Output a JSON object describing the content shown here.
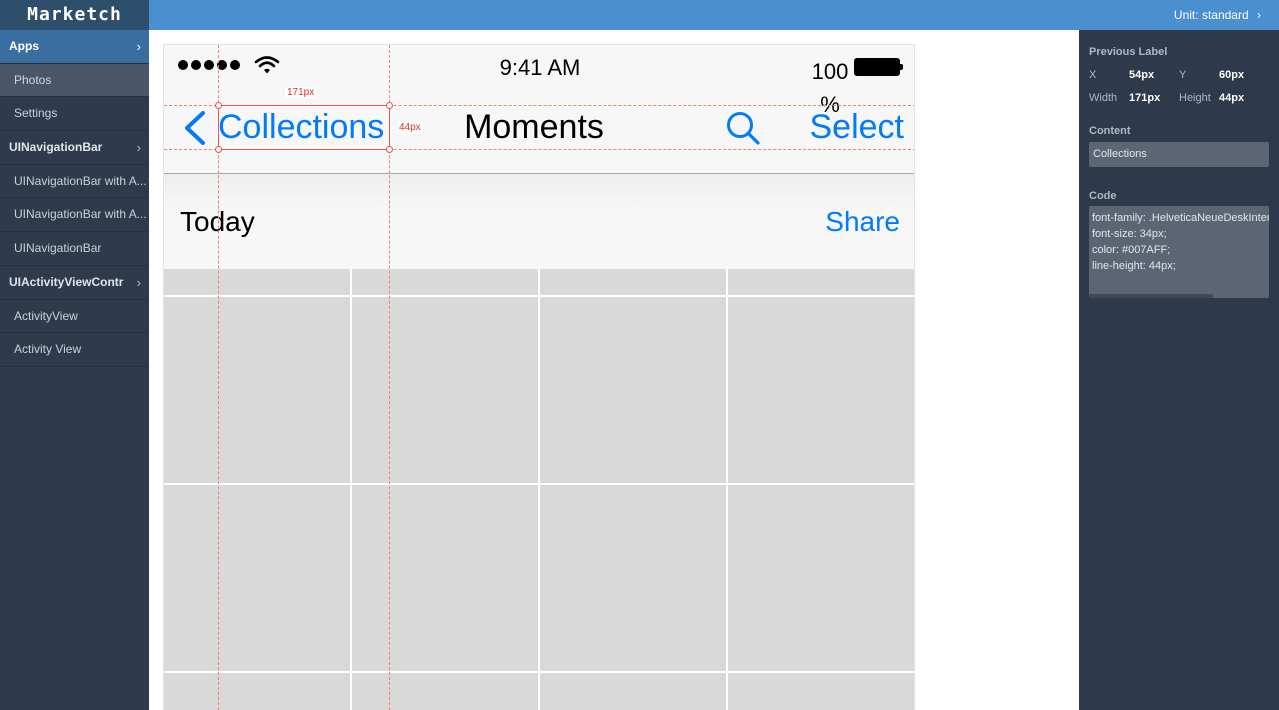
{
  "app": {
    "brand": "Marketch",
    "unit_label": "Unit:",
    "unit_value": "standard"
  },
  "sidebar": {
    "items": [
      {
        "label": "Apps",
        "kind": "group"
      },
      {
        "label": "Photos",
        "kind": "item"
      },
      {
        "label": "Settings",
        "kind": "item"
      },
      {
        "label": "UINavigationBar",
        "kind": "group"
      },
      {
        "label": "UINavigationBar with A...",
        "kind": "item"
      },
      {
        "label": "UINavigationBar with A...",
        "kind": "item"
      },
      {
        "label": "UINavigationBar",
        "kind": "item"
      },
      {
        "label": "UIActivityViewContr",
        "kind": "group"
      },
      {
        "label": "ActivityView",
        "kind": "item"
      },
      {
        "label": "Activity View",
        "kind": "item"
      }
    ]
  },
  "artboard": {
    "status_bar": {
      "time": "9:41 AM",
      "battery": "100 %"
    },
    "nav_bar": {
      "back_label": "Collections",
      "title": "Moments",
      "action": "Select"
    },
    "section": {
      "title": "Today",
      "action": "Share"
    },
    "measure": {
      "width_label": "171px",
      "height_label": "44px"
    }
  },
  "inspector": {
    "previous_label_title": "Previous Label",
    "x_label": "X",
    "x_value": "54px",
    "y_label": "Y",
    "y_value": "60px",
    "width_label": "Width",
    "width_value": "171px",
    "height_label": "Height",
    "height_value": "44px",
    "content_title": "Content",
    "content_value": "Collections",
    "code_title": "Code",
    "code_lines": [
      "font-family: .HelveticaNeueDeskInterface",
      "font-size: 34px;",
      "color: #007AFF;",
      "line-height: 44px;"
    ]
  },
  "colors": {
    "accent": "#007AFF",
    "topbar": "#4a8fcf",
    "sidebar": "#2f3b4c",
    "measure": "#e8584a"
  }
}
